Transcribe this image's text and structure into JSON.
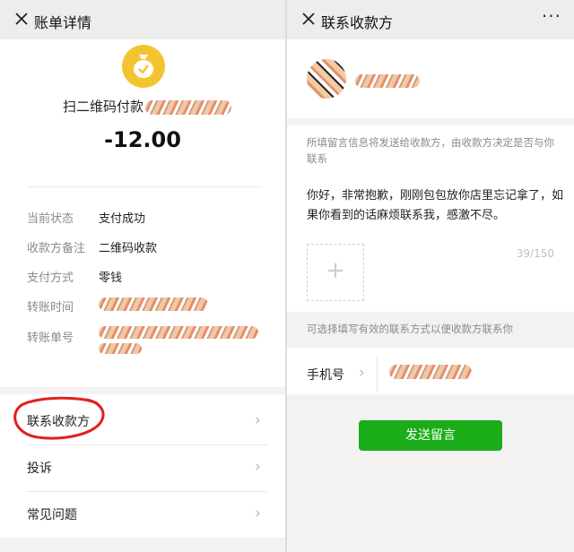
{
  "left": {
    "title": "账单详情",
    "payment_title": "扫二维码付款",
    "amount": "-12.00",
    "rows": [
      {
        "label": "当前状态",
        "value": "支付成功"
      },
      {
        "label": "收款方备注",
        "value": "二维码收款"
      },
      {
        "label": "支付方式",
        "value": "零钱"
      },
      {
        "label": "转账时间",
        "value": ""
      },
      {
        "label": "转账单号",
        "value": ""
      }
    ],
    "menu": [
      {
        "label": "联系收款方"
      },
      {
        "label": "投诉"
      },
      {
        "label": "常见问题"
      }
    ],
    "icons": {
      "close": "close-icon",
      "coin": "money-bag-icon",
      "chevron": "chevron-right-icon"
    },
    "colors": {
      "coin": "#f4c430",
      "highlight_circle": "#e02020"
    }
  },
  "right": {
    "title": "联系收款方",
    "hint": "所填留言信息将发送给收款方，由收款方决定是否与你联系",
    "message": "你好，非常抱歉，刚刚包包放你店里忘记拿了，如果你看到的话麻烦联系我，感激不尽。",
    "counter": "39/150",
    "contact_hint": "可选择填写有效的联系方式以便收款方联系你",
    "phone_label": "手机号",
    "send_button": "发送留言",
    "icons": {
      "close": "close-icon",
      "more": "more-dots-icon",
      "add": "plus-icon"
    },
    "colors": {
      "send_button": "#1aad19"
    }
  }
}
